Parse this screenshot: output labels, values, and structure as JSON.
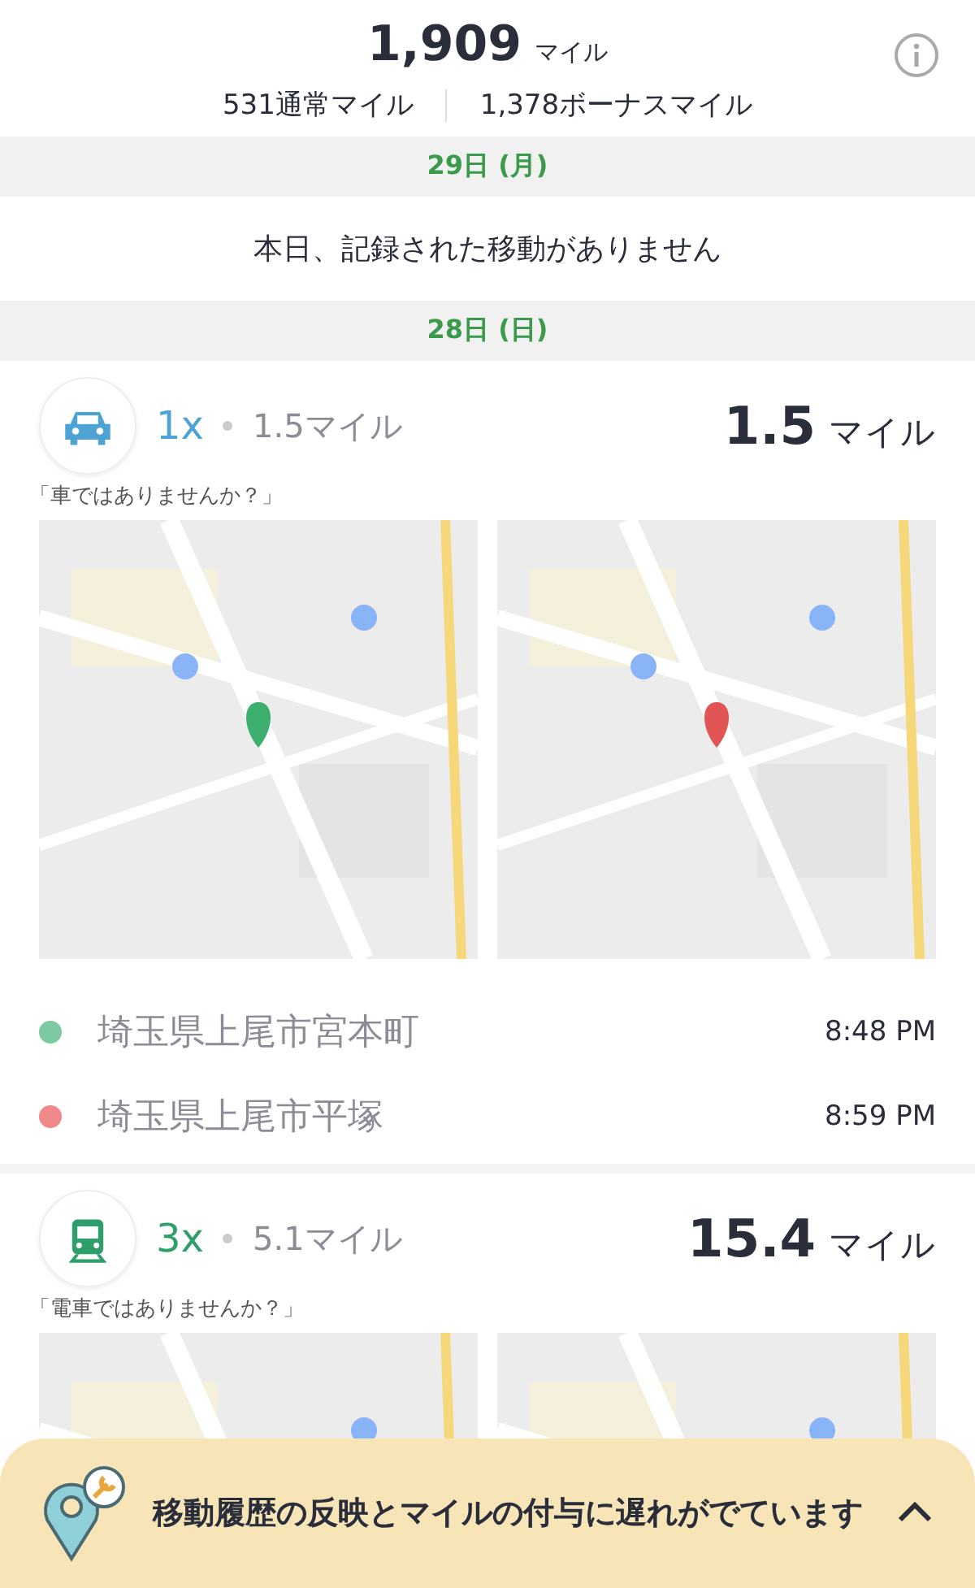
{
  "summary": {
    "total": "1,909",
    "total_unit": "マイル",
    "regular": "531通常マイル",
    "bonus": "1,378ボーナスマイル"
  },
  "days": [
    {
      "date": "29日 (月)",
      "empty_message": "本日、記録された移動がありません"
    },
    {
      "date": "28日 (日)",
      "trips": [
        {
          "kind": "car",
          "multiplier": "1x",
          "distance": "1.5マイル",
          "miles": "1.5",
          "miles_unit": "マイル",
          "question": "「車ではありませんか？」",
          "stops": [
            {
              "place": "埼玉県上尾市宮本町",
              "time": "8:48 PM",
              "color": "#7cc9a2"
            },
            {
              "place": "埼玉県上尾市平塚",
              "time": "8:59 PM",
              "color": "#f08a8a"
            }
          ]
        },
        {
          "kind": "train",
          "multiplier": "3x",
          "distance": "5.1マイル",
          "miles": "15.4",
          "miles_unit": "マイル",
          "question": "「電車ではありませんか？」"
        }
      ]
    }
  ],
  "banner": {
    "message": "移動履歴の反映とマイルの付与に遅れがでています",
    "expanded": false
  }
}
